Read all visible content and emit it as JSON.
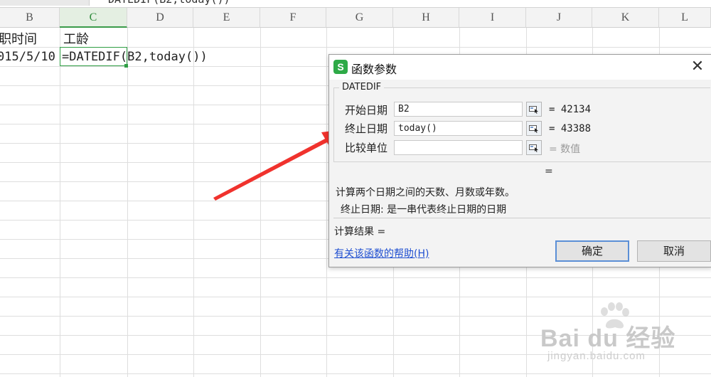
{
  "formula_bar": {
    "text": "DATEDIF(B2,today())"
  },
  "columns": [
    "B",
    "C",
    "D",
    "E",
    "F",
    "G",
    "H",
    "I",
    "J",
    "K",
    "L"
  ],
  "cells": {
    "b1": "职时间",
    "c1": "工龄",
    "b2": "015/5/10",
    "c2": "=DATEDIF(B2,today())"
  },
  "dialog": {
    "title": "函数参数",
    "close_symbol": "✕",
    "function_name": "DATEDIF",
    "args": [
      {
        "label": "开始日期",
        "value": "B2",
        "result": "= 42134"
      },
      {
        "label": "终止日期",
        "value": "today()",
        "result": "= 43388"
      },
      {
        "label": "比较单位",
        "value": "",
        "result": "= 数值"
      }
    ],
    "function_result": "=",
    "description": "计算两个日期之间的天数、月数或年数。",
    "arg_description": "终止日期:  是一串代表终止日期的日期",
    "calc_result": "计算结果 =",
    "help_link": "有关该函数的帮助(H)",
    "ok_label": "确定",
    "cancel_label": "取消",
    "logo_letter": "S",
    "accent_color": "#2eaa47"
  },
  "watermark": {
    "text": "Bai du 经验",
    "url": "jingyan.baidu.com"
  }
}
